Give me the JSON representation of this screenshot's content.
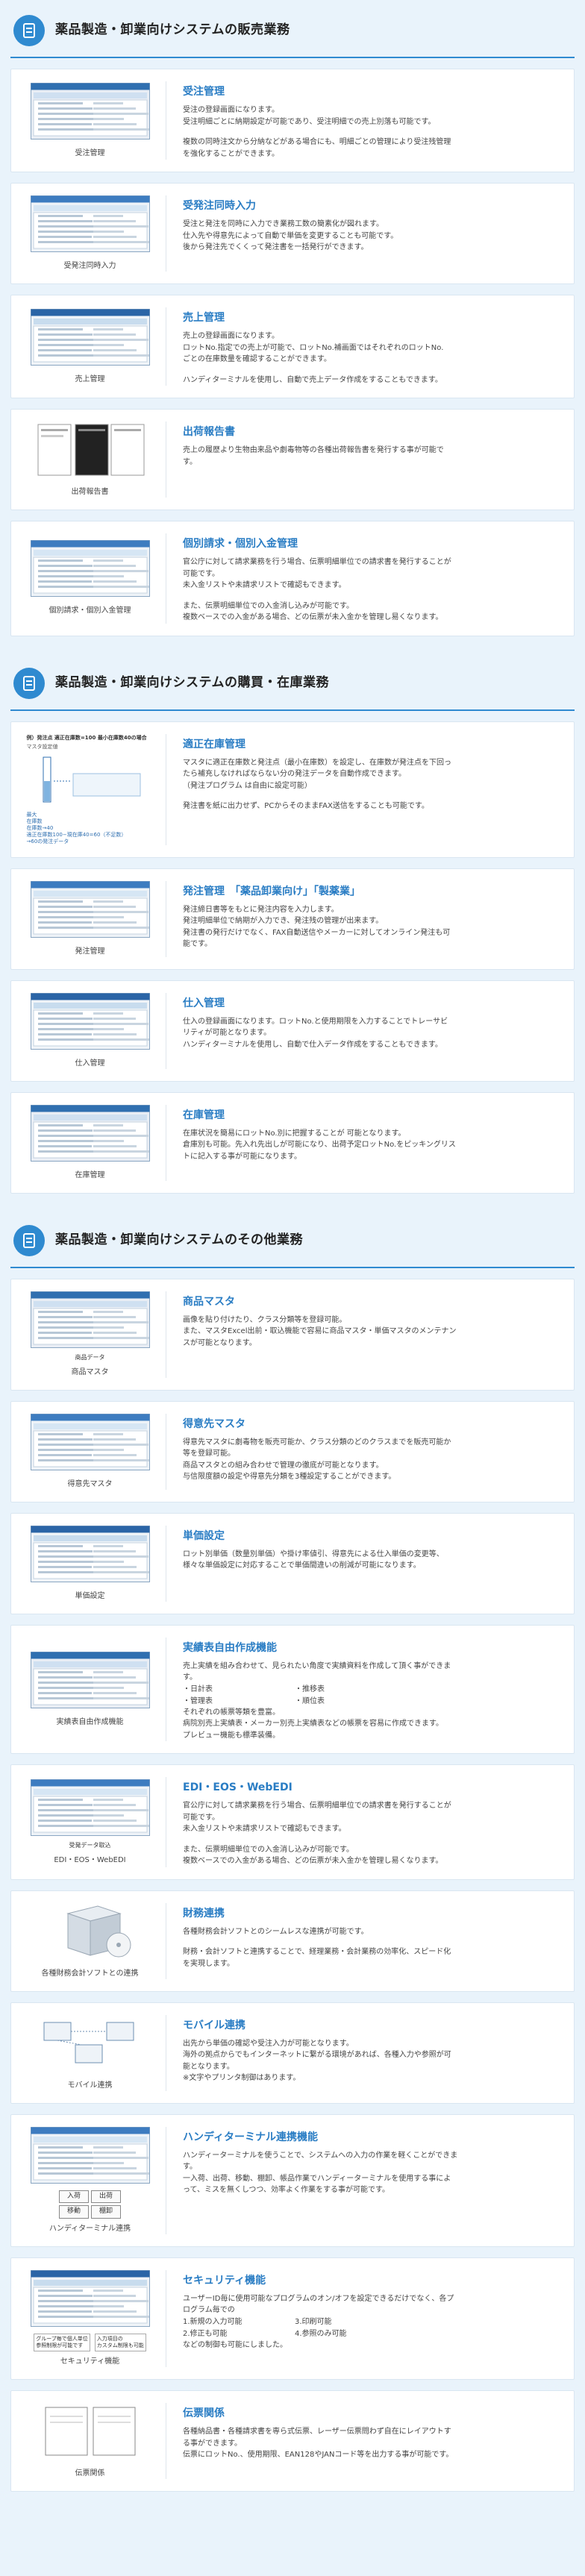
{
  "sections": [
    {
      "title": "薬品製造・卸業向けシステムの販売業務",
      "cards": [
        {
          "title": "受注管理",
          "caption": "受注管理",
          "lines": [
            "受注の登録画面になります。",
            "受注明細ごとに納期設定が可能であり、受注明細での売上別落も可能です。",
            "",
            "複数の同時注文から分納などがある場合にも、明細ごとの管理により受注残管理",
            "を強化することができます。"
          ]
        },
        {
          "title": "受発注同時入力",
          "caption": "受発注同時入力",
          "lines": [
            "受注と発注を同時に入力でき業務工数の簡素化が図れます。",
            "仕入先や得意先によって自動で単価を変更することも可能です。",
            "後から発注先でくくって発注書を一括発行ができます。"
          ]
        },
        {
          "title": "売上管理",
          "caption": "売上管理",
          "lines": [
            "売上の登録画面になります。",
            "ロットNo.指定での売上が可能で、ロットNo.補画面ではそれぞれのロットNo.",
            "ごとの在庫数量を確認することができます。",
            "",
            "ハンディターミナルを使用し、自動で売上データ作成をすることもできます。"
          ]
        },
        {
          "title": "出荷報告書",
          "caption": "出荷報告書",
          "lines": [
            "売上の履歴より生物由来品や劇毒物等の各種出荷報告書を発行する事が可能で",
            "す。"
          ]
        },
        {
          "title": "個別請求・個別入金管理",
          "caption": "個別請求・個別入金管理",
          "lines": [
            "官公庁に対して請求業務を行う場合、伝票明細単位での請求書を発行することが",
            "可能です。",
            "未入金リストや未請求リストで確認もできます。",
            "",
            "また、伝票明細単位での入金消し込みが可能です。",
            "複数ベースでの入金がある場合、どの伝票が未入金かを管理し易くなります。"
          ]
        }
      ]
    },
    {
      "title": "薬品製造・卸業向けシステムの購買・在庫業務",
      "cards": [
        {
          "title": "適正在庫管理",
          "caption": "",
          "lines": [
            "マスタに適正在庫数と発注点（最小在庫数）を設定し、在庫数が発注点を下回っ",
            "たら補充しなければならない分の発注データを自動作成できます。",
            "（発注プログラム は自由に設定可能）",
            "",
            "発注書を紙に出力せず、PCからそのままFAX送信をすることも可能です。"
          ],
          "diagram": {
            "line1": "例）発注点 適正在庫数=100 最小在庫数40の場合",
            "line2": "マスタ設定値",
            "s1": "最大",
            "s2": "在庫数",
            "s3": "在庫数→40",
            "s4": "適正在庫数100−現在庫40=60（不足数）",
            "s5": "→60の発注データ"
          }
        },
        {
          "title": "発注管理　「薬品卸業向け」「製薬業」",
          "caption": "発注管理",
          "lines": [
            "発注締日書等をもとに発注内容を入力します。",
            "発注明細単位で納期が入力でき、発注残の管理が出来ます。",
            "発注書の発行だけでなく、FAX自動送信やメーカーに対してオンライン発注も可",
            "能です。"
          ]
        },
        {
          "title": "仕入管理",
          "caption": "仕入管理",
          "lines": [
            "仕入の登録画面になります。ロットNo.と使用期限を入力することでトレーサビ",
            "リティが可能となります。",
            "ハンディターミナルを使用し、自動で仕入データ作成をすることもできます。"
          ]
        },
        {
          "title": "在庫管理",
          "caption": "在庫管理",
          "lines": [
            "在庫状況を簡易にロットNo.別に把握することが 可能となります。",
            "倉庫別も可能。先入れ先出しが可能になり、出荷予定ロットNo.をピッキングリス",
            "トに記入する事が可能になります。"
          ]
        }
      ]
    },
    {
      "title": "薬品製造・卸業向けシステムのその他業務",
      "cards": [
        {
          "title": "商品マスタ",
          "caption": "商品マスタ",
          "tag": "商品データ",
          "lines": [
            "画像を貼り付けたり、クラス分類等を登録可能。",
            "また、マスタExcel出前・取込機能で容易に商品マスタ・単価マスタのメンテナン",
            "スが可能となります。"
          ]
        },
        {
          "title": "得意先マスタ",
          "caption": "得意先マスタ",
          "lines": [
            "得意先マスタに劇毒物を販売可能か、クラス分類のどのクラスまでを販売可能か",
            "等を登録可能。",
            "商品マスタとの組み合わせで管理の徹底が可能となります。",
            "与信限度額の設定や得意先分類を3種設定することができます。"
          ]
        },
        {
          "title": "単価設定",
          "caption": "単価設定",
          "lines": [
            "ロット別単価（数量別単価）や掛け率値引、得意先による仕入単価の変更等、",
            "様々な単価設定に対応することで単価間違いの削減が可能になります。"
          ]
        },
        {
          "title": "実績表自由作成機能",
          "caption": "実績表自由作成機能",
          "lines": [
            "売上実績を組み合わせて、見られたい角度で実績資料を作成して頂く事ができま",
            "す。"
          ],
          "pairs": [
            [
              "・日計表",
              "・推移表"
            ],
            [
              "・管理表",
              "・順位表"
            ]
          ],
          "lines2": [
            "それぞれの帳票等類を豊富。",
            "病院別売上実績表・メーカー別売上実績表などの帳票を容易に作成できます。",
            "プレビュー機能も標準装備。"
          ]
        },
        {
          "title": "EDI・EOS・WebEDI",
          "caption": "EDI・EOS・WebEDI",
          "tag": "受発データ取込",
          "lines": [
            "官公庁に対して請求業務を行う場合、伝票明細単位での請求書を発行することが",
            "可能です。",
            "未入金リストや未請求リストで確認もできます。",
            "",
            "また、伝票明細単位での入金消し込みが可能です。",
            "複数ベースでの入金がある場合、どの伝票が未入金かを管理し易くなります。"
          ]
        },
        {
          "title": "財務連携",
          "caption": "各種財務会計ソフトとの連携",
          "lines": [
            "各種財務会計ソフトとのシームレスな連携が可能です。",
            "",
            "財務・会計ソフトと連携することで、経理業務・会計業務の効率化、スピード化",
            "を実現します。"
          ]
        },
        {
          "title": "モバイル連携",
          "caption": "モバイル連携",
          "lines": [
            "出先から単価の確認や受注入力が可能となります。",
            "海外の拠点からでもインターネットに繋がる環境があれば、各種入力や参照が可",
            "能となります。",
            "※文字やプリンタ制御はあります。"
          ]
        },
        {
          "title": "ハンディターミナル連携機能",
          "caption": "ハンディターミナル連携",
          "buttons": [
            "入荷",
            "出荷",
            "移動",
            "棚卸"
          ],
          "lines": [
            "ハンディーターミナルを使うことで、システムへの入力の作業を軽くことができま",
            "す。",
            "一入荷、出荷、移動、棚卸、帳品作業でハンディーターミナルを使用する事によ",
            "って、ミスを無くしつつ、効率よく作業をする事が可能です。"
          ]
        },
        {
          "title": "セキュリティ機能",
          "caption": "セキュリティ機能",
          "panel1": "グループ毎で個人単位\n参照制限が可能です",
          "panel2": "入力項目の\nカスタム制限も可能",
          "lines": [
            "ユーザーID毎に使用可能なプログラムのオン/オフを設定できるだけでなく、各プ",
            "ログラム毎での"
          ],
          "pairs": [
            [
              "1.新規の入力可能",
              "3.印刷可能"
            ],
            [
              "2.修正も可能",
              "4.参照のみ可能"
            ]
          ],
          "lines2": [
            "などの制御も可能にしました。"
          ]
        },
        {
          "title": "伝票関係",
          "caption": "伝票関係",
          "lines": [
            "各種納品書・各種請求書を専ら式伝票、レーザー伝票問わず自在にレイアウトす",
            "る事ができます。",
            "伝票にロットNo.、使用期限、EAN128やJANコード等を出力する事が可能です。"
          ]
        }
      ]
    }
  ]
}
